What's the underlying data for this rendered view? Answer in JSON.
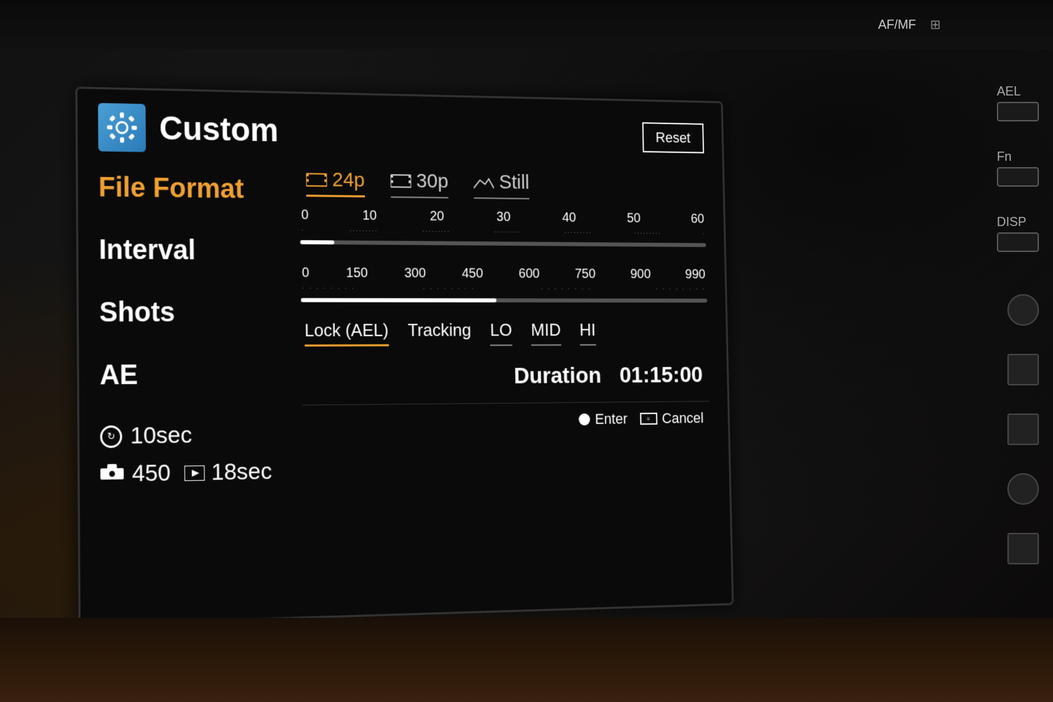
{
  "camera": {
    "side_labels": [
      "AF/MF",
      "AEL",
      "Fn",
      "DISP"
    ]
  },
  "screen": {
    "header": {
      "icon_alt": "custom-settings-icon",
      "title": "Custom",
      "reset_button": "Reset"
    },
    "file_format": {
      "label": "File Format",
      "options": [
        {
          "label": "24p",
          "selected": true,
          "prefix": "film"
        },
        {
          "label": "30p",
          "selected": false,
          "prefix": "film"
        },
        {
          "label": "Still",
          "selected": false,
          "prefix": "mountain"
        }
      ]
    },
    "interval": {
      "label": "Interval",
      "slider": {
        "min": 0,
        "max": 60,
        "value": 5,
        "ticks": [
          "0",
          "10",
          "20",
          "30",
          "40",
          "50",
          "60"
        ],
        "fill_percent": 8
      }
    },
    "shots": {
      "label": "Shots",
      "slider": {
        "min": 0,
        "max": 990,
        "value": 450,
        "ticks": [
          "0",
          "150",
          "300",
          "450",
          "600",
          "750",
          "900",
          "990"
        ],
        "fill_percent": 47
      }
    },
    "ae": {
      "label": "AE",
      "options": [
        {
          "label": "Lock (AEL)",
          "selected": true
        },
        {
          "label": "Tracking",
          "selected": false
        },
        {
          "label": "LO",
          "selected": false
        },
        {
          "label": "MID",
          "selected": false
        },
        {
          "label": "HI",
          "selected": false
        }
      ]
    },
    "bottom_left": {
      "interval_icon": "⟳",
      "interval_value": "10sec",
      "camera_icon": "📷",
      "shots_value": "450",
      "playback_icon": "▶",
      "playback_value": "18sec"
    },
    "duration": {
      "label": "Duration",
      "value": "01:15:00"
    },
    "controls": {
      "enter_circle": "●",
      "enter_label": "Enter",
      "cancel_icon": "MENU",
      "cancel_label": "Cancel"
    }
  }
}
